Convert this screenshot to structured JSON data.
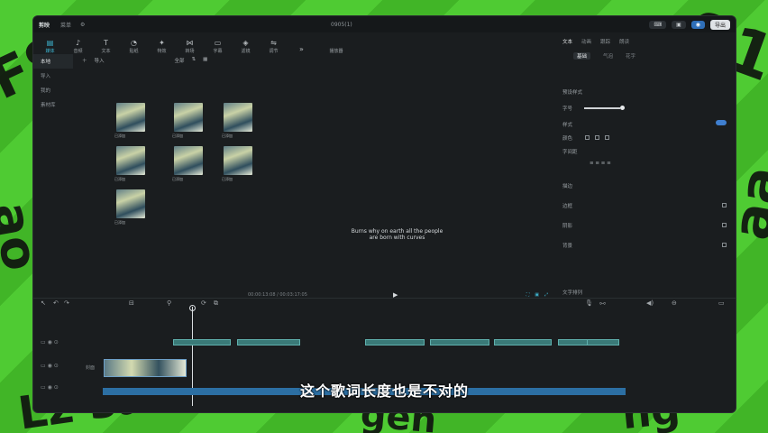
{
  "titlebar": {
    "brand": "剪映",
    "menu": "菜单",
    "window_title": "0905(1)",
    "export_label": "导出"
  },
  "toolbar": {
    "items": [
      {
        "label": "媒体",
        "icon": "media-icon"
      },
      {
        "label": "音频",
        "icon": "audio-icon"
      },
      {
        "label": "文本",
        "icon": "text-icon"
      },
      {
        "label": "贴纸",
        "icon": "sticker-icon"
      },
      {
        "label": "特效",
        "icon": "effect-icon"
      },
      {
        "label": "转场",
        "icon": "transition-icon"
      },
      {
        "label": "字幕",
        "icon": "subtitle-icon"
      },
      {
        "label": "滤镜",
        "icon": "filter-icon"
      },
      {
        "label": "调节",
        "icon": "adjust-icon"
      }
    ],
    "player_label": "播放器"
  },
  "leftnav": {
    "items": [
      "本地",
      "导入",
      "我的",
      "素材库"
    ]
  },
  "media": {
    "import_label": "导入",
    "filter_label": "全部",
    "thumbs": [
      "已添加",
      "已添加",
      "已添加",
      "已添加",
      "已添加",
      "已添加",
      "已添加"
    ]
  },
  "player": {
    "lyric_line1": "Burns why on earth all the people",
    "lyric_line2": "are born with curves",
    "time": "00:00:13:08 / 00:03:17:05"
  },
  "inspector": {
    "tabs": [
      "文本",
      "动画",
      "跟踪",
      "朗读"
    ],
    "subtabs": [
      "基础",
      "气泡",
      "花字"
    ],
    "rows": [
      "预设样式",
      "字号",
      "样式",
      "颜色",
      "字间距",
      "描边",
      "边框",
      "阴影",
      "背景",
      "文字排列"
    ]
  },
  "timeline": {
    "track_label": "封面"
  },
  "subtitle": "这个歌词长度也是不对的"
}
